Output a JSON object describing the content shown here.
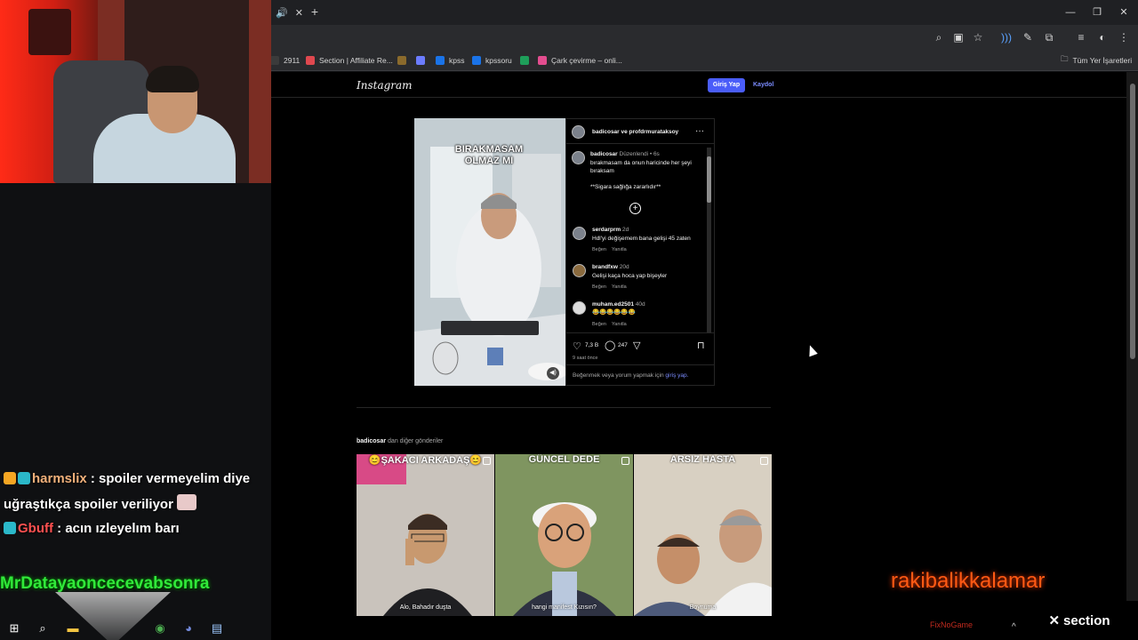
{
  "browser": {
    "bookmarks": [
      {
        "label": "2911",
        "color": "#3b3b3b"
      },
      {
        "label": "Section | Affiliate Re...",
        "color": "#e0484f"
      },
      {
        "label": "",
        "color": "#8a6a2c"
      },
      {
        "label": "",
        "color": "#6b7cff"
      },
      {
        "label": "kpss",
        "color": "#1a73e8"
      },
      {
        "label": "kpssoru",
        "color": "#1a73e8"
      },
      {
        "label": "",
        "color": "#1e9e5a"
      },
      {
        "label": "Çark çevirme – onli...",
        "color": "#e34d8f"
      }
    ],
    "all_bookmarks": "Tüm Yer İşaretleri"
  },
  "instagram": {
    "logo": "Instagram",
    "login_button": "Giriş Yap",
    "signup_link": "Kaydol",
    "post": {
      "media_caption": "BIRAKMASAM OLMAZ MI",
      "header_user": "badicosar ve profdrmurataksoy",
      "caption_user": "badicosar",
      "caption_meta": "Düzenlendi • 6s",
      "caption_line1": "bırakmasam da onun haricinde her şeyi",
      "caption_line2": "bıraksam",
      "caption_line3": "**Sigara sağlığa zararlıdır**",
      "comments": [
        {
          "user": "serdarprm",
          "age": "2d",
          "text": "Hdl'yi değişemem bana gelişi 45 zaten",
          "like": "Beğen",
          "reply": "Yanıtla"
        },
        {
          "user": "brandfxw",
          "age": "20d",
          "text": "Gelişi kaça hoca yap bişeyler",
          "like": "Beğen",
          "reply": "Yanıtla"
        },
        {
          "user": "muham.ed2501",
          "age": "40d",
          "text": "😂😂😂😂😂😂",
          "like": "Beğen",
          "reply": "Yanıtla"
        }
      ],
      "likes": "7,3 B",
      "comment_count": "247",
      "posted_ago": "9 saat önce",
      "login_prompt": "Beğenmek veya yorum yapmak için",
      "login_prompt_link": "giriş yap."
    },
    "more_posts": {
      "user": "badicosar",
      "suffix": "dan diğer gönderiler",
      "items": [
        {
          "title": "😊ŞAKACI ARKADAŞ😊",
          "caption": "Alo, Bahadır duşta",
          "bg": "#c9c3bc"
        },
        {
          "title": "GÜNCEL DEDE",
          "caption": "hangi manifest Kızısın?",
          "bg": "#8b9a6a"
        },
        {
          "title": "ARSIZ HASTA",
          "caption": "Boynuma",
          "bg": "#d2cabd"
        }
      ]
    }
  },
  "stream": {
    "chat": [
      {
        "user": "harmslix",
        "user_color": "#f0b07a",
        "text": ": spoiler vermeyelim diye",
        "text2": "uğraştıkça spoiler veriliyor"
      },
      {
        "user": "Gbuff",
        "user_color": "#ff5050",
        "text": ": acın ızleyelım barı"
      }
    ],
    "alert_name": "MrDatayaoncecevabsonra",
    "raki": "rakibalikkalamar",
    "sponsor": "section",
    "fixnogame": "FixNoGame"
  }
}
